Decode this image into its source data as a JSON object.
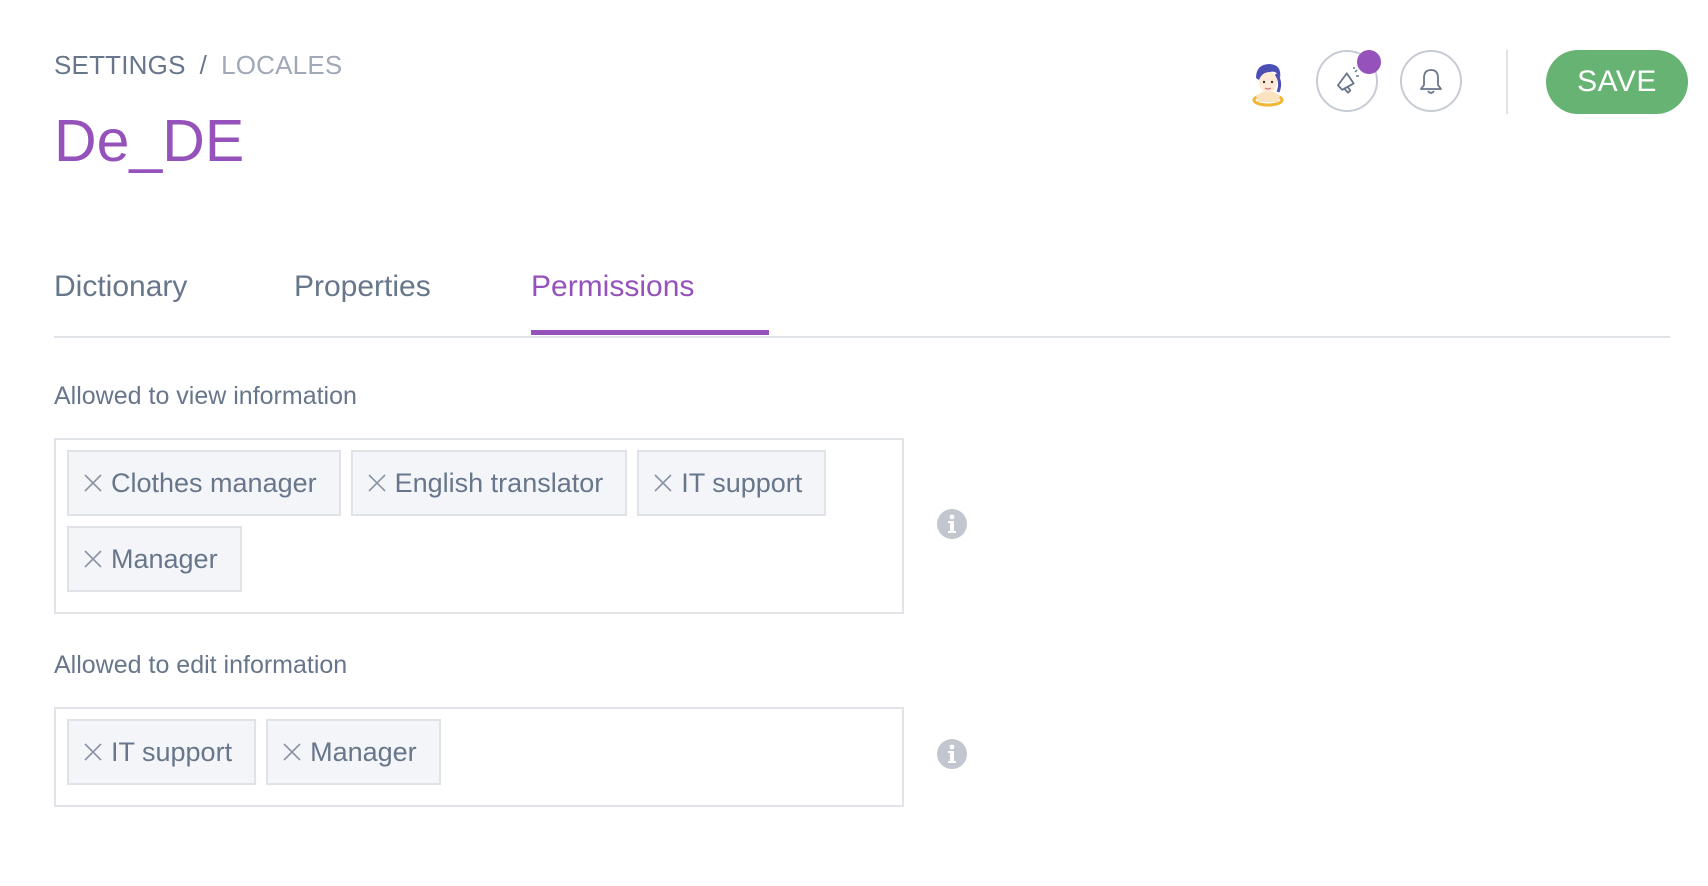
{
  "breadcrumb": {
    "parent": "SETTINGS",
    "separator": "/",
    "current": "LOCALES"
  },
  "page_title": "De_DE",
  "header": {
    "save_label": "SAVE",
    "has_notification": true
  },
  "tabs": [
    {
      "label": "Dictionary",
      "active": false
    },
    {
      "label": "Properties",
      "active": false
    },
    {
      "label": "Permissions",
      "active": true
    }
  ],
  "view_section": {
    "label": "Allowed to view information",
    "tags": [
      "Clothes manager",
      "English translator",
      "IT support",
      "Manager"
    ]
  },
  "edit_section": {
    "label": "Allowed to edit information",
    "tags": [
      "IT support",
      "Manager"
    ]
  },
  "colors": {
    "accent": "#9452ba",
    "save": "#67b373",
    "text": "#67768a",
    "muted": "#a1a9b8"
  },
  "icons": [
    "avatar",
    "megaphone-icon",
    "bell-icon",
    "remove-tag-icon",
    "info-icon"
  ]
}
